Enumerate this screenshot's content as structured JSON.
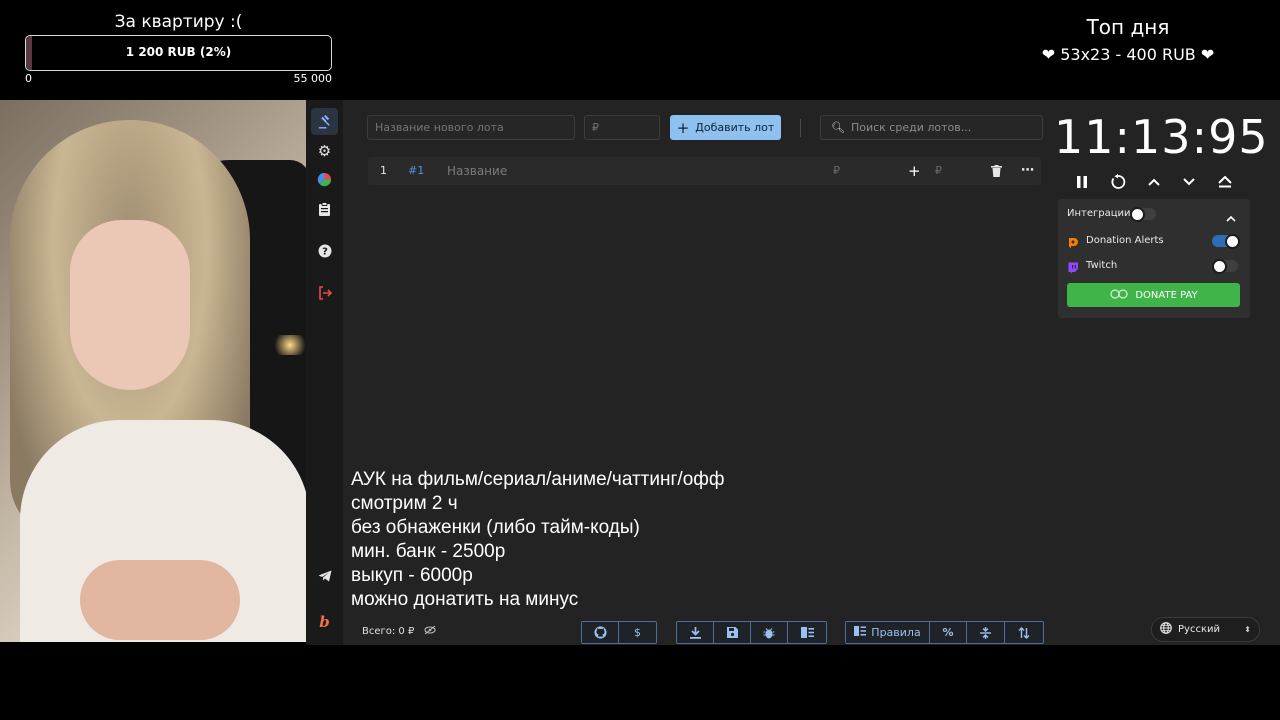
{
  "overlay": {
    "goal_title": "За квартиру :(",
    "goal_amount": "1 200 RUB (2%)",
    "goal_percent": 2,
    "goal_min": "0",
    "goal_max": "55 000",
    "top_title": "Топ дня",
    "top_line": "❤ 53x23 - 400 RUB ❤"
  },
  "sidebar": {
    "items": [
      "gavel-icon",
      "gear-icon",
      "pie-chart-icon",
      "clipboard-icon",
      "help-icon",
      "logout-icon"
    ],
    "bottom": [
      "telegram-icon",
      "brand-logo-icon"
    ]
  },
  "toolbar": {
    "lot_name_placeholder": "Название нового лота",
    "lot_amount_placeholder": "₽",
    "add_label": "Добавить лот",
    "search_placeholder": "Поиск среди лотов..."
  },
  "lot_row": {
    "index": "1",
    "id": "#1",
    "name_placeholder": "Название",
    "amount_placeholder": "₽",
    "add_amount_placeholder": "₽"
  },
  "timer": {
    "value": "11:13:95"
  },
  "integrations": {
    "title": "Интеграции",
    "items": [
      {
        "name": "Donation Alerts",
        "enabled": true
      },
      {
        "name": "Twitch",
        "enabled": false
      }
    ],
    "donate_pay": "DONATE PAY"
  },
  "rules_text": [
    "АУК на фильм/сериал/аниме/чаттинг/офф",
    "смотрим 2 ч",
    "без обнаженки (либо тайм-коды)",
    "мин. банк - 2500р",
    "выкуп - 6000р",
    "можно донатить на минус"
  ],
  "footer": {
    "total": "Всего: 0 ₽",
    "rules_button": "Правила",
    "language": "Русский"
  },
  "colors": {
    "accent": "#8ec0f0",
    "donate_green": "#3fb449",
    "logout_red": "#e84a4a",
    "twitch_purple": "#9146ff",
    "da_orange": "#f57d07"
  }
}
